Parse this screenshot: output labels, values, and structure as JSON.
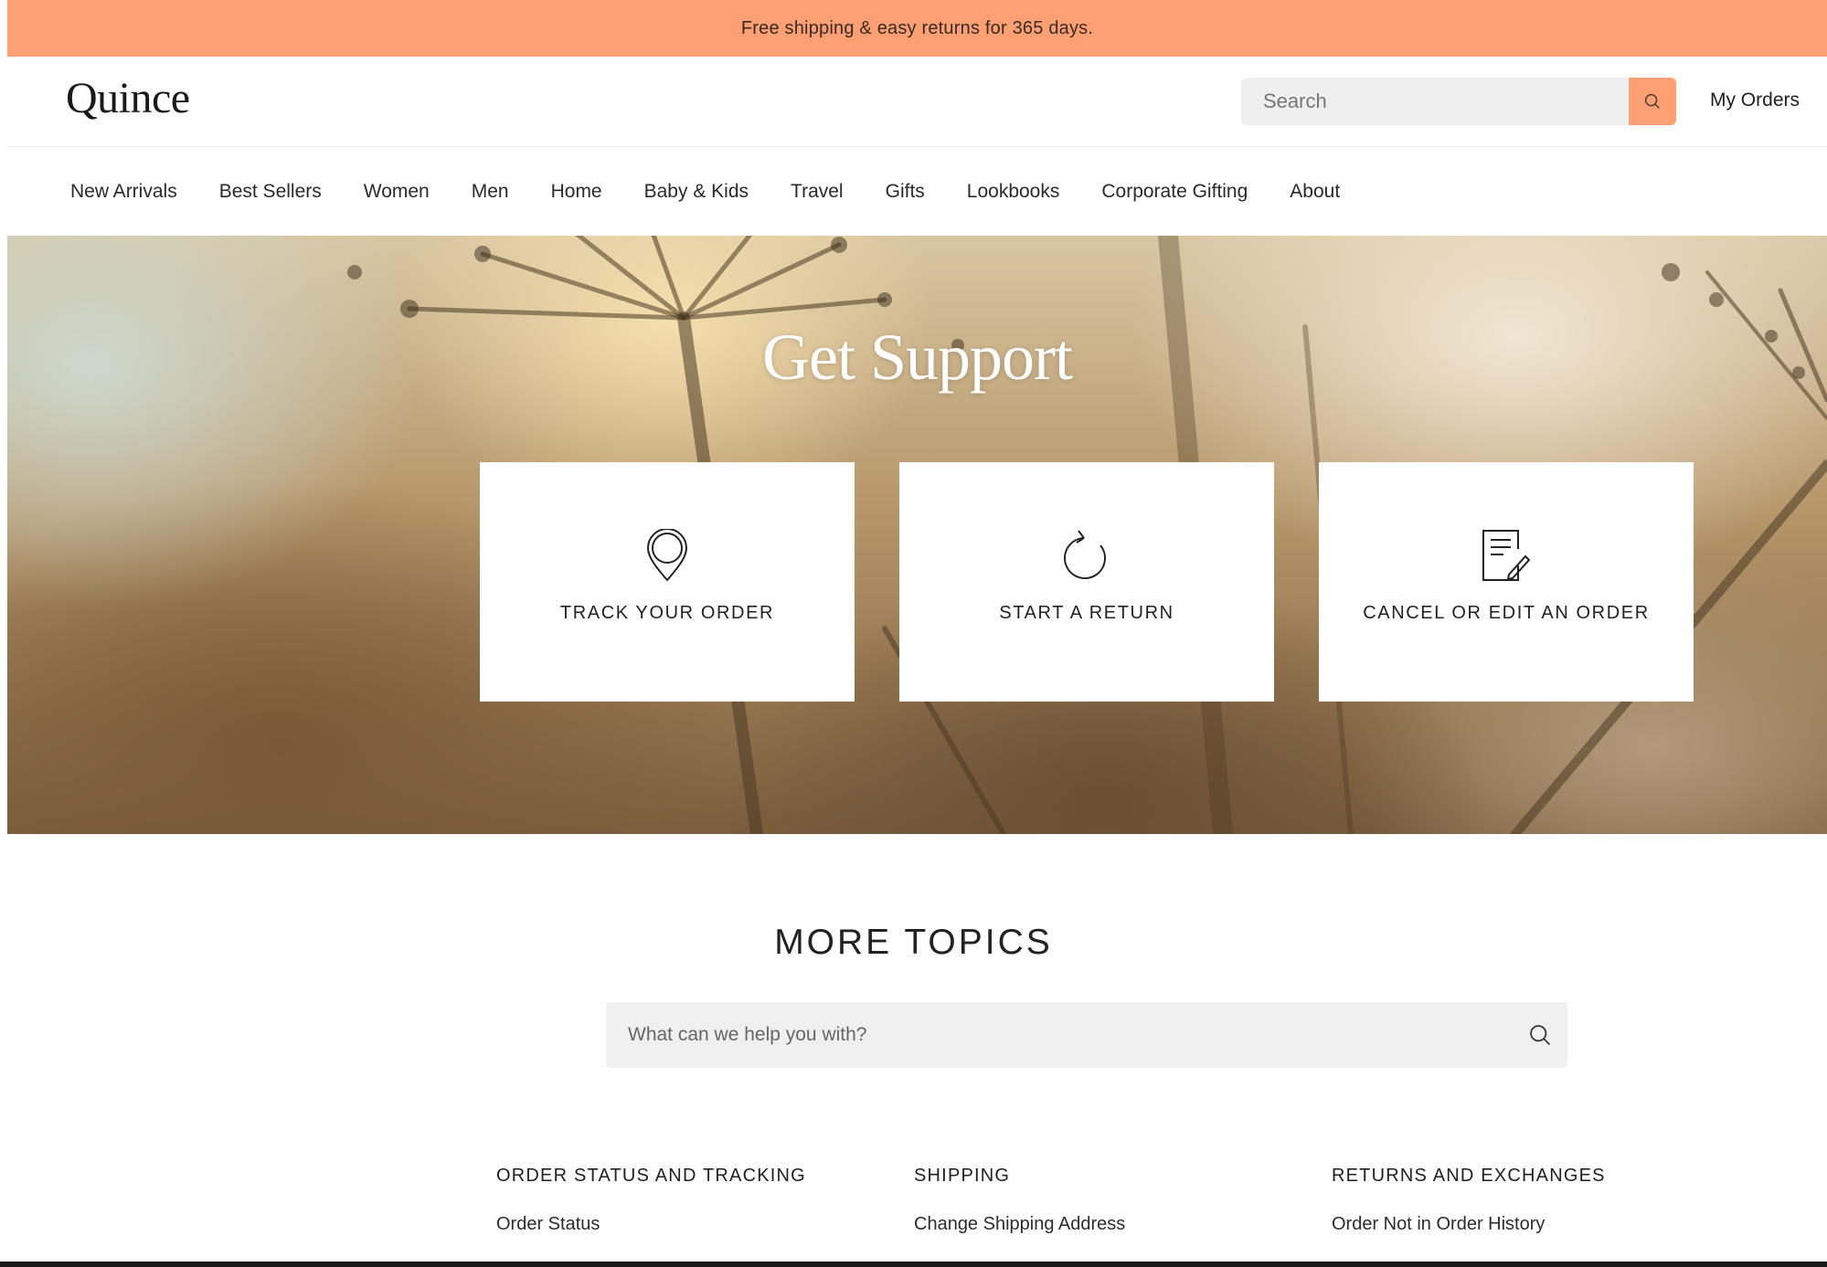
{
  "promo": {
    "text": "Free shipping & easy returns for 365 days."
  },
  "header": {
    "logo": "Quince",
    "search_placeholder": "Search",
    "my_orders": "My Orders"
  },
  "nav": {
    "items": [
      "New Arrivals",
      "Best Sellers",
      "Women",
      "Men",
      "Home",
      "Baby & Kids",
      "Travel",
      "Gifts",
      "Lookbooks",
      "Corporate Gifting",
      "About"
    ]
  },
  "hero": {
    "title": "Get Support",
    "cards": [
      {
        "label": "TRACK YOUR ORDER",
        "icon": "location-pin-icon"
      },
      {
        "label": "START A RETURN",
        "icon": "return-arrow-icon"
      },
      {
        "label": "CANCEL OR EDIT AN ORDER",
        "icon": "edit-document-icon"
      }
    ]
  },
  "topics": {
    "title": "MORE TOPICS",
    "search_placeholder": "What can we help you with?",
    "columns": [
      {
        "title": "ORDER STATUS AND TRACKING",
        "links": [
          "Order Status"
        ]
      },
      {
        "title": "SHIPPING",
        "links": [
          "Change Shipping Address"
        ]
      },
      {
        "title": "RETURNS AND EXCHANGES",
        "links": [
          "Order Not in Order History"
        ]
      }
    ]
  },
  "colors": {
    "accent": "#ff9f74"
  }
}
